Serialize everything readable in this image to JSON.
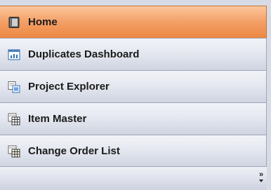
{
  "nav": {
    "items": [
      {
        "label": "Home",
        "icon": "home-icon",
        "active": true
      },
      {
        "label": "Duplicates Dashboard",
        "icon": "dashboard-icon"
      },
      {
        "label": "Project Explorer",
        "icon": "project-explorer-icon"
      },
      {
        "label": "Item Master",
        "icon": "item-master-icon"
      },
      {
        "label": "Change Order List",
        "icon": "change-order-list-icon"
      }
    ],
    "overflow_glyph": "»"
  },
  "colors": {
    "active_top": "#fbc79b",
    "active_bottom": "#eb8742",
    "bar_top": "#f1f3f8",
    "bar_bottom": "#cfd4e1",
    "border": "#9fa6b8"
  }
}
